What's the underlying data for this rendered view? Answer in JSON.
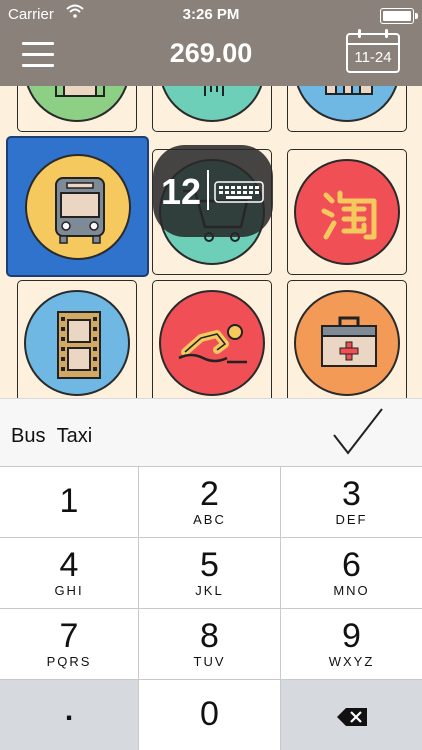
{
  "status_bar": {
    "carrier": "Carrier",
    "time": "3:26 PM"
  },
  "nav": {
    "amount": "269.00",
    "date": "11-24"
  },
  "categories": [
    {
      "icon": "shopping-bag-icon",
      "color": "#8ecf86"
    },
    {
      "icon": "clothing-icon",
      "color": "#6ecfb9"
    },
    {
      "icon": "building-icon",
      "color": "#6fb8e4"
    },
    {
      "icon": "bus-icon",
      "color": "#f6c95e",
      "selected": true
    },
    {
      "icon": "shopping-cart-icon",
      "color": "#6ecfb9"
    },
    {
      "icon": "taobao-icon",
      "color": "#ef4f55"
    },
    {
      "icon": "film-icon",
      "color": "#6fb8e4"
    },
    {
      "icon": "swimming-icon",
      "color": "#ef4f55"
    },
    {
      "icon": "medical-kit-icon",
      "color": "#f39a56"
    }
  ],
  "entry": {
    "value": "12"
  },
  "note": {
    "text": "Bus Taxi"
  },
  "keypad": [
    {
      "num": "1",
      "sub": ""
    },
    {
      "num": "2",
      "sub": "ABC"
    },
    {
      "num": "3",
      "sub": "DEF"
    },
    {
      "num": "4",
      "sub": "GHI"
    },
    {
      "num": "5",
      "sub": "JKL"
    },
    {
      "num": "6",
      "sub": "MNO"
    },
    {
      "num": "7",
      "sub": "PQRS"
    },
    {
      "num": "8",
      "sub": "TUV"
    },
    {
      "num": "9",
      "sub": "WXYZ"
    },
    {
      "num": ".",
      "sub": ""
    },
    {
      "num": "0",
      "sub": ""
    },
    {
      "num": "",
      "sub": ""
    }
  ]
}
